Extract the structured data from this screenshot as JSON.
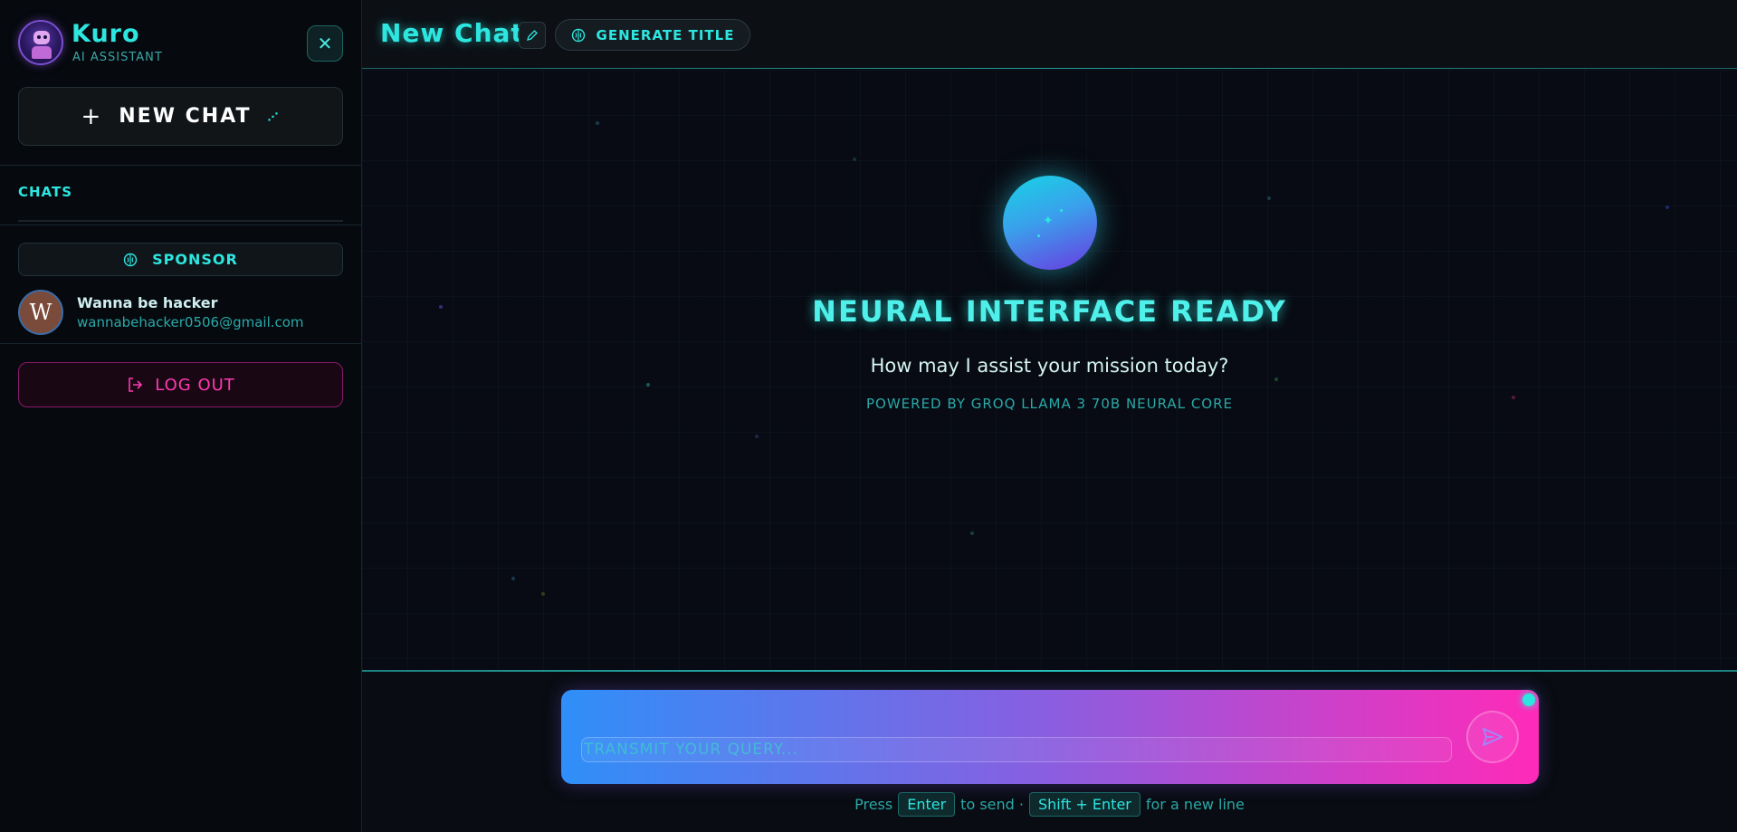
{
  "sidebar": {
    "brand_name": "Kuro",
    "brand_subtitle": "AI ASSISTANT",
    "close_icon": "✕",
    "new_chat_label": "NEW CHAT",
    "chats_label": "CHATS",
    "sponsor_label": "SPONSOR",
    "user": {
      "initial": "W",
      "name": "Wanna be hacker",
      "email": "wannabehacker0506@gmail.com"
    },
    "logout_label": "LOG OUT"
  },
  "header": {
    "title": "New Chat",
    "generate_title_label": "GENERATE TITLE"
  },
  "welcome": {
    "title": "NEURAL INTERFACE READY",
    "subtitle": "How may I assist your mission today?",
    "powered_by": "POWERED BY GROQ LLAMA 3 70B NEURAL CORE"
  },
  "composer": {
    "placeholder": "TRANSMIT YOUR QUERY...",
    "hint_press": "Press",
    "hint_enter_key": "Enter",
    "hint_to_send": "to send ·",
    "hint_shift_enter_key": "Shift + Enter",
    "hint_new_line": "for a new line"
  },
  "colors": {
    "accent_cyan": "#2de6e0",
    "accent_pink": "#ff3ab0",
    "background": "#070a10"
  },
  "icons": {
    "close": "close-icon",
    "plus": "plus-icon",
    "edit": "pencil-icon",
    "generate": "brain-icon",
    "sponsor": "brain-icon",
    "logout": "logout-icon",
    "send": "send-icon"
  }
}
